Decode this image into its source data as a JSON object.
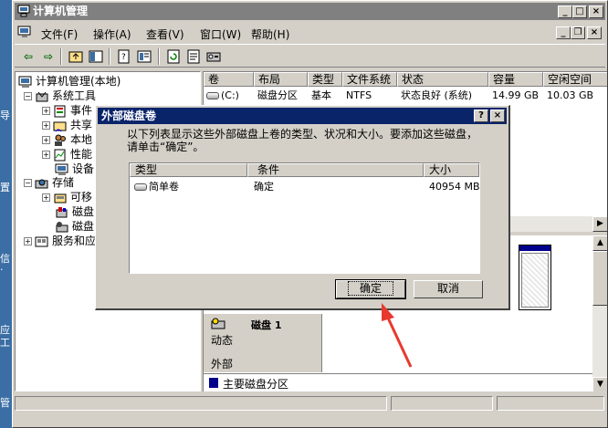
{
  "desktop": {
    "left_glyphs": [
      "导",
      "置",
      "信",
      "·",
      "应",
      "工",
      "管"
    ]
  },
  "window": {
    "title": "计算机管理",
    "min": "_",
    "max": "□",
    "close": "×",
    "mdi_min": "_",
    "mdi_restore": "❐",
    "mdi_close": "×"
  },
  "menu": {
    "items": [
      "文件(F)",
      "操作(A)",
      "查看(V)",
      "窗口(W)",
      "帮助(H)"
    ]
  },
  "toolbar": {
    "back": "⇦",
    "forward": "⇨"
  },
  "tree": {
    "root": "计算机管理(本地)",
    "system_tools": "系统工具",
    "event": "事件",
    "shared": "共享",
    "local": "本地",
    "perf": "性能",
    "device": "设备",
    "storage": "存储",
    "removable": "可移",
    "disk1": "磁盘",
    "disk2": "磁盘",
    "services": "服务和应"
  },
  "volume_table": {
    "columns": [
      "卷",
      "布局",
      "类型",
      "文件系统",
      "状态",
      "容量",
      "空闲空间"
    ],
    "rows": [
      {
        "volume": "(C:)",
        "layout": "磁盘分区",
        "type": "基本",
        "fs": "NTFS",
        "status": "状态良好 (系统)",
        "capacity": "14.99 GB",
        "free": "10.03 GB"
      }
    ]
  },
  "disk_map": {
    "disk_label": "磁盘 1",
    "disk_status": "动态",
    "disk_type": "外部",
    "legend": "主要磁盘分区",
    "legend_color": "#00008b"
  },
  "dialog": {
    "title": "外部磁盘卷",
    "help": "?",
    "close": "×",
    "message_line1": "以下列表显示这些外部磁盘上卷的类型、状况和大小。要添加这些磁盘，",
    "message_line2": "请单击“确定”。",
    "columns": [
      "类型",
      "条件",
      "大小"
    ],
    "rows": [
      {
        "type": "简单卷",
        "condition": "确定",
        "size": "40954 MB"
      }
    ],
    "ok_label": "确定",
    "cancel_label": "取消"
  },
  "annotation_color": "#e8392f"
}
